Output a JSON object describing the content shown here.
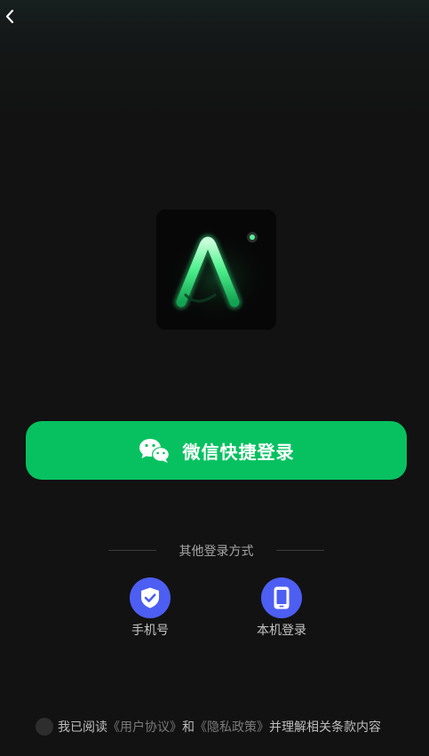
{
  "nav": {
    "back_icon": "chevron-left-icon"
  },
  "logo": {
    "text": "AI",
    "accent_color": "#3ee882"
  },
  "wechat_login": {
    "label": "微信快捷登录",
    "icon": "wechat-icon",
    "background_color": "#07c160"
  },
  "other_methods": {
    "title": "其他登录方式",
    "options": [
      {
        "label": "手机号",
        "icon": "shield-check-icon"
      },
      {
        "label": "本机登录",
        "icon": "smartphone-icon"
      }
    ],
    "icon_color": "#4d5ef2"
  },
  "agreement": {
    "prefix": "我已阅读",
    "user_agreement": "《用户协议》",
    "conjunction": "和",
    "privacy_policy": "《隐私政策》",
    "suffix": "并理解相关条款内容",
    "checked": false
  }
}
